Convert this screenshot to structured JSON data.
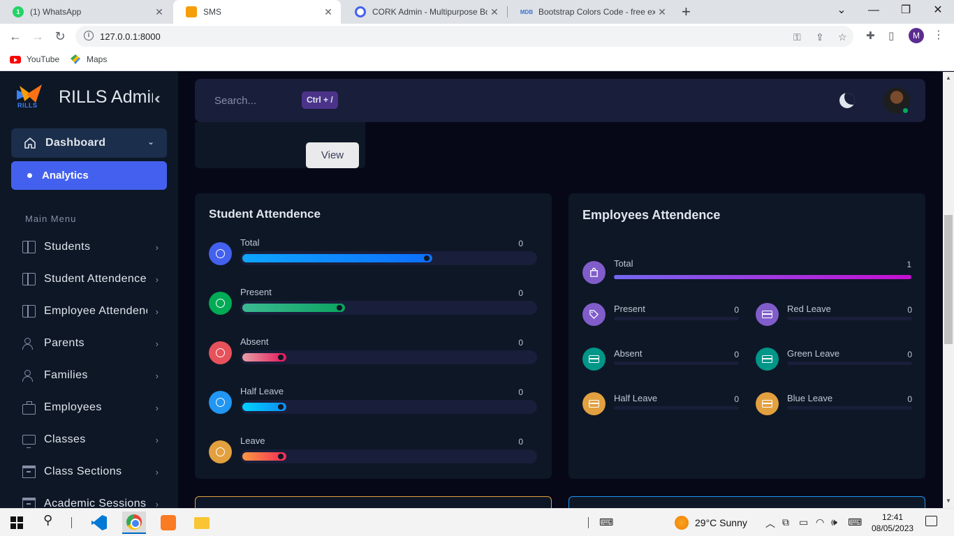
{
  "browser": {
    "tabs": [
      {
        "title": "(1) WhatsApp",
        "icon": "whatsapp-icon",
        "color": "#25d366",
        "badge": "1"
      },
      {
        "title": "SMS",
        "icon": "rills-icon",
        "color": "#f59e0b",
        "badge": ""
      },
      {
        "title": "CORK Admin - Multipurpose Boo",
        "icon": "cork-icon",
        "color": "#4361ee",
        "badge": "C"
      },
      {
        "title": "Bootstrap Colors Code - free exa",
        "icon": "mdb-icon",
        "color": "#3b71ca",
        "badge": "MDB"
      }
    ],
    "url": "127.0.0.1:8000",
    "profile_initial": "M",
    "bookmarks": [
      {
        "label": "YouTube",
        "icon": "youtube-icon"
      },
      {
        "label": "Maps",
        "icon": "maps-icon"
      }
    ]
  },
  "sidebar": {
    "brand": "RILLS Admin",
    "logo_text": "RILLS",
    "dashboard_label": "Dashboard",
    "analytics_label": "Analytics",
    "menu_heading": "Main Menu",
    "items": [
      {
        "label": "Students",
        "icon": "book-icon"
      },
      {
        "label": "Student Attendence",
        "icon": "book-icon"
      },
      {
        "label": "Employee Attendence",
        "icon": "book-icon"
      },
      {
        "label": "Parents",
        "icon": "users-icon"
      },
      {
        "label": "Families",
        "icon": "users-icon"
      },
      {
        "label": "Employees",
        "icon": "briefcase-icon"
      },
      {
        "label": "Classes",
        "icon": "monitor-icon"
      },
      {
        "label": "Class Sections",
        "icon": "archive-icon"
      },
      {
        "label": "Academic Sessions",
        "icon": "archive-icon"
      }
    ]
  },
  "header": {
    "search_placeholder": "Search...",
    "shortcut": "Ctrl + /"
  },
  "top_card": {
    "view_label": "View"
  },
  "student_attendance": {
    "title": "Student Attendence",
    "rows": [
      {
        "label": "Total",
        "value": "0",
        "fill_pct": 65,
        "color": "#4361ee",
        "gradient": "linear-gradient(90deg,#0ea5ff,#0d6efd)",
        "icon": "chrome-icon"
      },
      {
        "label": "Present",
        "value": "0",
        "fill_pct": 35,
        "color": "#00ab55",
        "gradient": "linear-gradient(90deg,#3cba92,#0ba360)",
        "icon": "compass-icon"
      },
      {
        "label": "Absent",
        "value": "0",
        "fill_pct": 15,
        "color": "#e7515a",
        "gradient": "linear-gradient(90deg,#e7a0a6,#e7155a)",
        "icon": "globe-icon"
      },
      {
        "label": "Half Leave",
        "value": "0",
        "fill_pct": 15,
        "color": "#2196f3",
        "gradient": "linear-gradient(90deg,#00d2ff,#0e8bf2)",
        "icon": "globe-icon"
      },
      {
        "label": "Leave",
        "value": "0",
        "fill_pct": 15,
        "color": "#e2a03f",
        "gradient": "linear-gradient(90deg,#fc9842,#f52b56)",
        "icon": "globe-icon"
      }
    ]
  },
  "employee_attendance": {
    "title": "Employees Attendence",
    "total": {
      "label": "Total",
      "value": "1",
      "fill_pct": 100,
      "color": "#805dca",
      "gradient": "linear-gradient(90deg,#7367f0,#c50fd0)",
      "icon": "bag-icon"
    },
    "items": [
      {
        "label": "Present",
        "value": "0",
        "color": "#805dca",
        "icon": "tag-icon"
      },
      {
        "label": "Red Leave",
        "value": "0",
        "color": "#805dca",
        "icon": "credit-card-icon"
      },
      {
        "label": "Absent",
        "value": "0",
        "color": "#009688",
        "icon": "credit-card-icon"
      },
      {
        "label": "Green Leave",
        "value": "0",
        "color": "#009688",
        "icon": "credit-card-icon"
      },
      {
        "label": "Half Leave",
        "value": "0",
        "color": "#e2a03f",
        "icon": "credit-card-icon"
      },
      {
        "label": "Blue Leave",
        "value": "0",
        "color": "#e2a03f",
        "icon": "credit-card-icon"
      }
    ]
  },
  "taskbar": {
    "weather": "29°C  Sunny",
    "time": "12:41",
    "date": "08/05/2023"
  }
}
